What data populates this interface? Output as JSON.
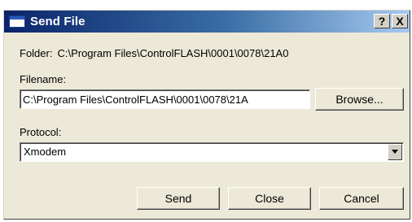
{
  "window": {
    "title": "Send File",
    "help_label": "?",
    "close_label": "X"
  },
  "folder": {
    "label": "Folder:",
    "value": "C:\\Program Files\\ControlFLASH\\0001\\0078\\21A0"
  },
  "filename": {
    "label": "Filename:",
    "value": "C:\\Program Files\\ControlFLASH\\0001\\0078\\21A"
  },
  "protocol": {
    "label": "Protocol:",
    "selected": "Xmodem"
  },
  "buttons": {
    "browse": "Browse...",
    "send": "Send",
    "close": "Close",
    "cancel": "Cancel"
  },
  "icons": {
    "window": "window-icon",
    "dropdown": "chevron-down-icon"
  },
  "colors": {
    "titlebar_start": "#0a246a",
    "titlebar_end": "#a6caf0",
    "dialog_bg": "#ece9d8"
  }
}
